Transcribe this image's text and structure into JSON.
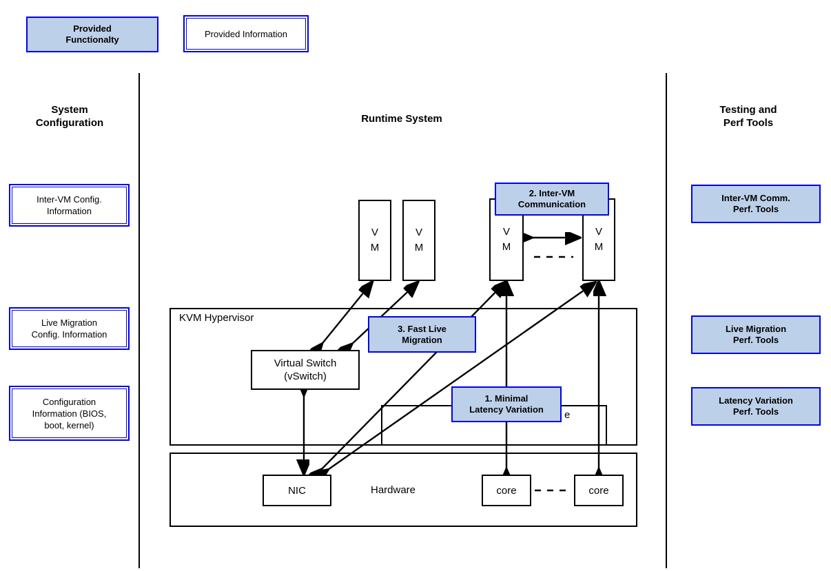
{
  "legend": {
    "functionality": "Provided\nFunctionalty",
    "functionality_line1": "Provided",
    "functionality_line2": "Functionalty",
    "information": "Provided Information"
  },
  "columns": {
    "left": {
      "title_line1": "System",
      "title_line2": "Configuration",
      "items": [
        {
          "line1": "Inter-VM Config.",
          "line2": "Information"
        },
        {
          "line1": "Live Migration",
          "line2": "Config. Information"
        },
        {
          "line1": "Configuration",
          "line2": "Information (BIOS,",
          "line3": "boot, kernel)"
        }
      ]
    },
    "center": {
      "title": "Runtime System"
    },
    "right": {
      "title_line1": "Testing and",
      "title_line2": "Perf Tools",
      "items": [
        {
          "line1": "Inter-VM Comm.",
          "line2": "Perf. Tools"
        },
        {
          "line1": "Live Migration",
          "line2": "Perf. Tools"
        },
        {
          "line1": "Latency Variation",
          "line2": "Perf. Tools"
        }
      ]
    }
  },
  "runtime": {
    "vms": [
      {
        "line1": "V",
        "line2": "M"
      },
      {
        "line1": "V",
        "line2": "M"
      },
      {
        "line1": "V",
        "line2": "M"
      },
      {
        "line1": "V",
        "line2": "M"
      }
    ],
    "hypervisor_label": "KVM Hypervisor",
    "vswitch": {
      "line1": "Virtual Switch",
      "line2": "(vSwitch)"
    },
    "hidden_module_label": "e",
    "hardware_label": "Hardware",
    "nic_label": "NIC",
    "cores": [
      "core",
      "core"
    ]
  },
  "callouts": [
    {
      "id": "minimal-latency",
      "line1": "1. Minimal",
      "line2": "Latency Variation"
    },
    {
      "id": "inter-vm-comm",
      "line1": "2. Inter-VM",
      "line2": "Communication"
    },
    {
      "id": "fast-live-migration",
      "line1": "3. Fast Live",
      "line2": "Migration"
    }
  ],
  "colors": {
    "fill_blue": "#bdd0e9",
    "border_blue": "#0000ee",
    "stroke_black": "#000000",
    "background": "#ffffff"
  }
}
